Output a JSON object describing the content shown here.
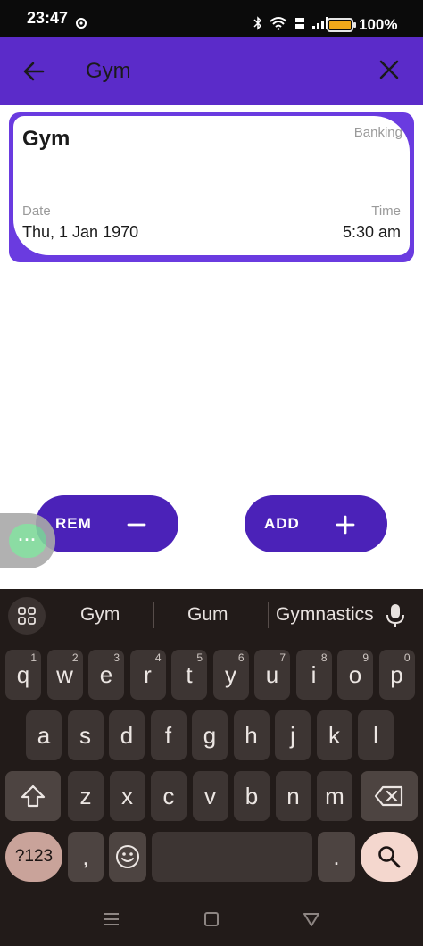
{
  "status_bar": {
    "time": "23:47",
    "battery_text": "100%",
    "battery_level": 100,
    "icons": [
      "settings-gear-icon",
      "bluetooth-icon",
      "wifi-icon",
      "volte-icon",
      "signal-icon",
      "battery-icon"
    ]
  },
  "app_bar": {
    "search_value": "Gym",
    "back_icon": "arrow-left-icon",
    "clear_icon": "close-icon"
  },
  "card": {
    "title": "Gym",
    "category": "Banking",
    "date_label": "Date",
    "date_value": "Thu, 1 Jan 1970",
    "time_label": "Time",
    "time_value": "5:30 am"
  },
  "buttons": {
    "rem_label": "REM",
    "add_label": "ADD"
  },
  "bubble": {
    "label": "···"
  },
  "keyboard": {
    "suggestions": [
      "Gym",
      "Gum",
      "Gymnastics"
    ],
    "row1": [
      {
        "key": "q",
        "num": "1"
      },
      {
        "key": "w",
        "num": "2"
      },
      {
        "key": "e",
        "num": "3"
      },
      {
        "key": "r",
        "num": "4"
      },
      {
        "key": "t",
        "num": "5"
      },
      {
        "key": "y",
        "num": "6"
      },
      {
        "key": "u",
        "num": "7"
      },
      {
        "key": "i",
        "num": "8"
      },
      {
        "key": "o",
        "num": "9"
      },
      {
        "key": "p",
        "num": "0"
      }
    ],
    "row2": [
      "a",
      "s",
      "d",
      "f",
      "g",
      "h",
      "j",
      "k",
      "l"
    ],
    "row3": [
      "z",
      "x",
      "c",
      "v",
      "b",
      "n",
      "m"
    ],
    "symbols_label": "?123",
    "comma": ",",
    "period": "."
  },
  "colors": {
    "accent": "#5b2bc9",
    "button": "#4b22b8",
    "keyboard_bg": "#221b19"
  }
}
